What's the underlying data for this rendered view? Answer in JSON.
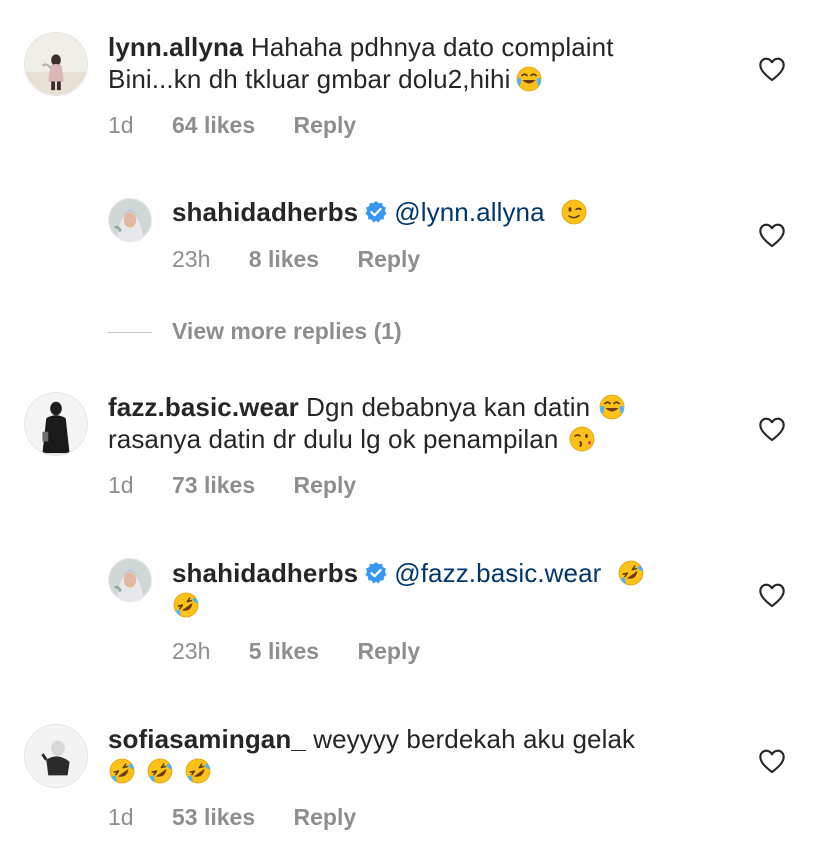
{
  "comments": [
    {
      "username": "lynn.allyna",
      "text_line1": "Hahaha pdhnya dato complaint",
      "text_line2": "Bini...kn dh tkluar gmbar dolu2,hihi",
      "emojis": [
        "face-with-tears-of-joy"
      ],
      "time": "1d",
      "likes": "64 likes",
      "reply": "Reply"
    },
    {
      "username": "shahidadherbs",
      "verified": true,
      "mention": "@lynn.allyna",
      "emojis": [
        "winking-face"
      ],
      "time": "23h",
      "likes": "8 likes",
      "reply": "Reply"
    },
    {
      "username": "fazz.basic.wear",
      "text_line1": "Dgn debabnya kan datin",
      "text_line2": "rasanya datin dr dulu lg ok penampilan",
      "emojis": [
        "face-with-tears-of-joy",
        "face-blowing-a-kiss"
      ],
      "time": "1d",
      "likes": "73 likes",
      "reply": "Reply"
    },
    {
      "username": "shahidadherbs",
      "verified": true,
      "mention": "@fazz.basic.wear",
      "emojis": [
        "rolling-on-the-floor-laughing",
        "rolling-on-the-floor-laughing"
      ],
      "time": "23h",
      "likes": "5 likes",
      "reply": "Reply"
    },
    {
      "username": "sofiasamingan_",
      "text_line1": "weyyyy berdekah aku gelak",
      "emojis": [
        "rolling-on-the-floor-laughing",
        "rolling-on-the-floor-laughing",
        "rolling-on-the-floor-laughing"
      ],
      "time": "1d",
      "likes": "53 likes",
      "reply": "Reply"
    }
  ],
  "view_more_replies": "View more replies (1)",
  "icons": {
    "like": "heart-outline-icon",
    "verified": "verified-badge-icon"
  },
  "colors": {
    "text": "#262626",
    "secondary": "#8e8e8e",
    "mention": "#00376b",
    "verified": "#3897f0"
  }
}
